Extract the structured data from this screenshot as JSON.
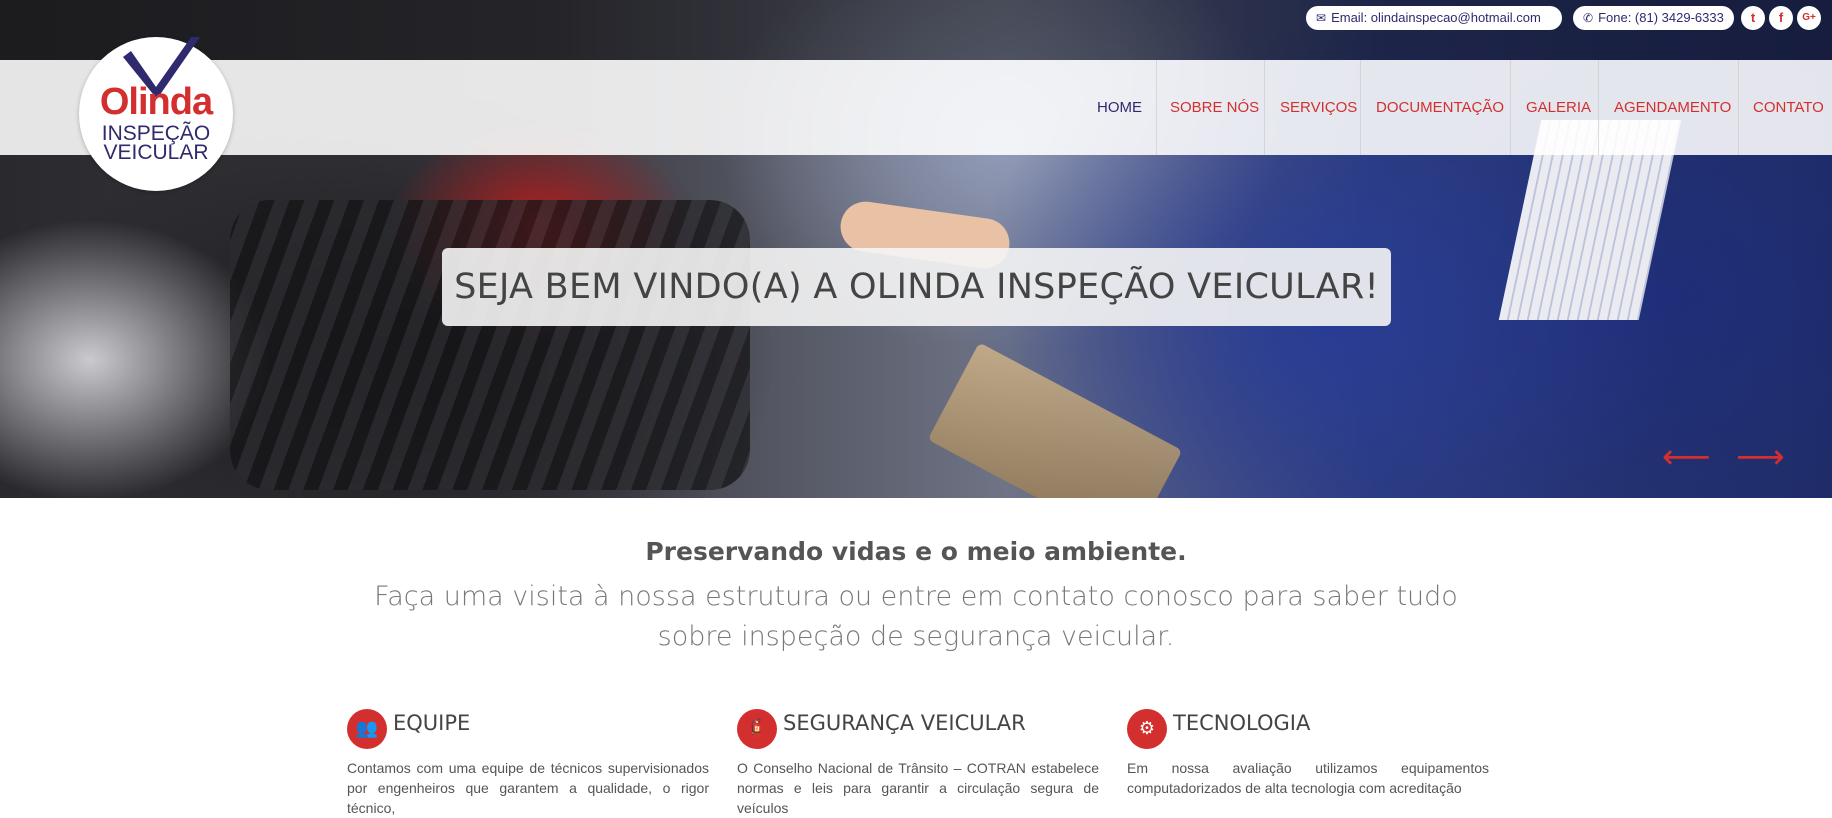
{
  "topbar": {
    "email_label": "Email: olindainspecao@hotmail.com",
    "phone_label": "Fone: (81) 3429-6333",
    "social": [
      {
        "icon": "twitter-icon",
        "glyph": "t"
      },
      {
        "icon": "facebook-icon",
        "glyph": "f"
      },
      {
        "icon": "google-plus-icon",
        "glyph": "G+"
      }
    ]
  },
  "logo": {
    "name": "Olinda",
    "line1": "INSPEÇÃO",
    "line2": "VEICULAR",
    "check_color": "#2f2a6e"
  },
  "nav": {
    "items": [
      "HOME",
      "SOBRE NÓS",
      "SERVIÇOS",
      "DOCUMENTAÇÃO",
      "GALERIA",
      "AGENDAMENTO",
      "CONTATO"
    ],
    "active": "HOME"
  },
  "hero": {
    "welcome": "SEJA BEM VINDO(A) A OLINDA INSPEÇÃO VEICULAR!",
    "prev_arrow": "⟵",
    "next_arrow": "⟶"
  },
  "intro": {
    "title": "Preservando vidas e o meio ambiente.",
    "subtitle": "Faça uma visita à nossa estrutura ou entre em contato conosco para saber tudo sobre inspeção de segurança veicular."
  },
  "features": [
    {
      "icon": "team-icon",
      "title": "EQUIPE",
      "text": "Contamos com uma equipe de técnicos supervisionados por engenheiros que garantem a qualidade, o rigor técnico,"
    },
    {
      "icon": "fire-extinguisher-icon",
      "title": "SEGURANÇA VEICULAR",
      "text": "O Conselho Nacional de Trânsito – COTRAN estabelece normas e leis para garantir a circulação segura de veículos"
    },
    {
      "icon": "gears-icon",
      "title": "TECNOLOGIA",
      "text": "Em nossa avaliação utilizamos equipamentos computadorizados de alta tecnologia com acreditação"
    }
  ],
  "colors": {
    "brand_red": "#d32f2f",
    "brand_navy": "#2f2a6e"
  }
}
